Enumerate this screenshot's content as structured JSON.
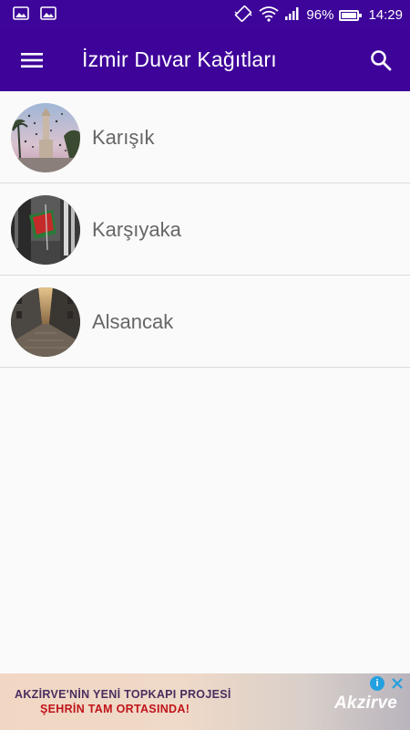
{
  "status_bar": {
    "battery_percent": "96%",
    "battery_level": 0.96,
    "time": "14:29"
  },
  "app_bar": {
    "title": "İzmir Duvar Kağıtları",
    "menu_icon": "menu-icon",
    "search_icon": "search-icon"
  },
  "categories": [
    {
      "label": "Karışık"
    },
    {
      "label": "Karşıyaka"
    },
    {
      "label": "Alsancak"
    }
  ],
  "ad": {
    "line1": "AKZİRVE'NİN YENİ TOPKAPI PROJESİ",
    "line2": "ŞEHRİN TAM ORTASINDA!",
    "brand": "Akzirve",
    "info_icon": "info-icon",
    "close_icon": "close-icon"
  },
  "colors": {
    "primary": "#3e0499",
    "background": "#fafafa",
    "divider": "#dcdcdc",
    "label_text": "#666666"
  }
}
